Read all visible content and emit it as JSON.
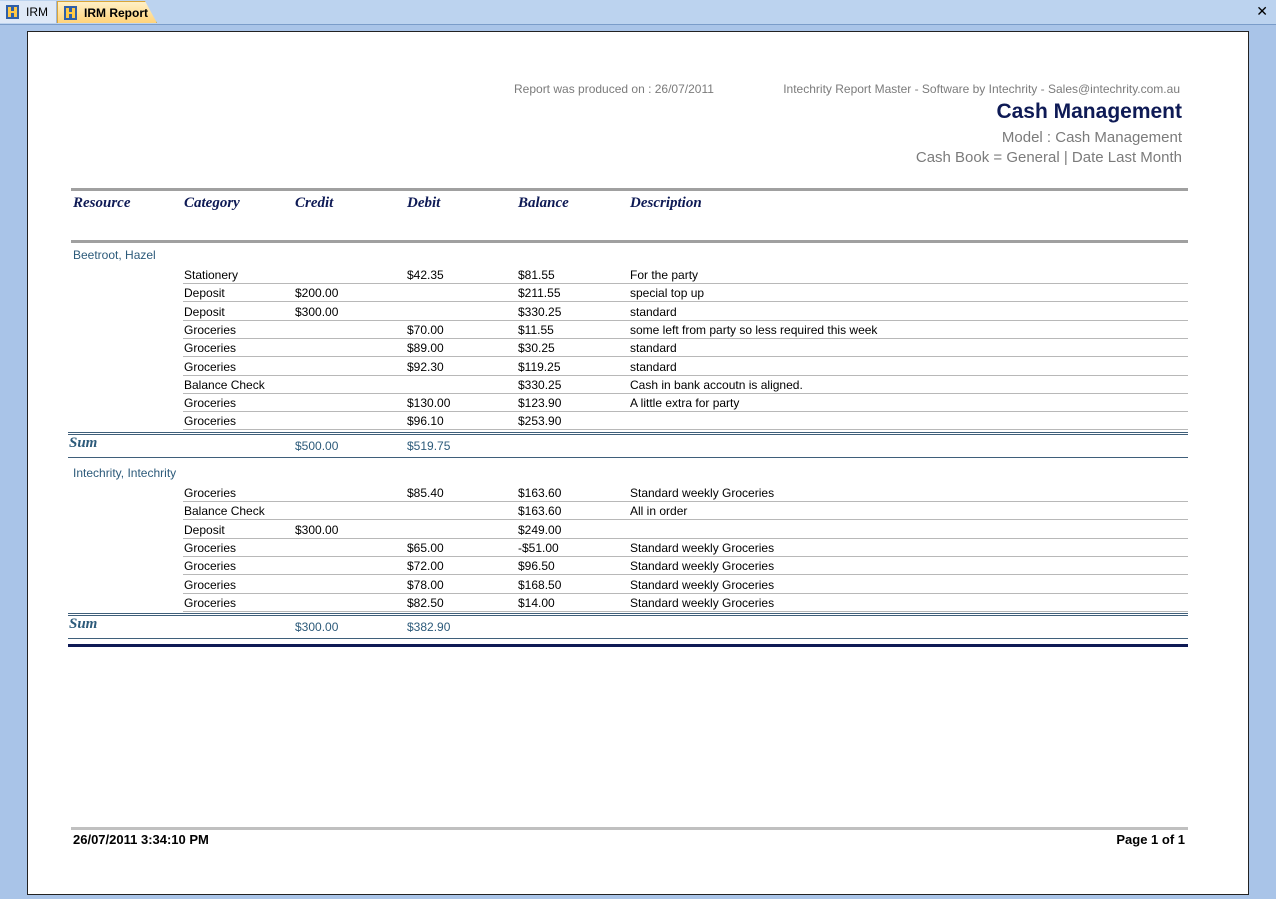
{
  "tabs": [
    {
      "label": "IRM",
      "icon": "app-logo-icon"
    },
    {
      "label": "IRM Report",
      "icon": "app-logo-icon"
    }
  ],
  "close_glyph": "✕",
  "header": {
    "produced": "Report was produced on : 26/07/2011",
    "software": "Intechrity Report Master -   Software by Intechrity  -   Sales@intechrity.com.au",
    "title": "Cash Management",
    "model": "Model : Cash Management",
    "filter": "Cash Book = General | Date Last Month"
  },
  "columns": [
    "Resource",
    "Category",
    "Credit",
    "Debit",
    "Balance",
    "Description"
  ],
  "groups": [
    {
      "name": "Beetroot, Hazel",
      "rows": [
        {
          "category": "Stationery",
          "credit": "",
          "debit": "$42.35",
          "balance": "$81.55",
          "description": "For the party"
        },
        {
          "category": "Deposit",
          "credit": "$200.00",
          "debit": "",
          "balance": "$211.55",
          "description": "special top up"
        },
        {
          "category": "Deposit",
          "credit": "$300.00",
          "debit": "",
          "balance": "$330.25",
          "description": "standard"
        },
        {
          "category": "Groceries",
          "credit": "",
          "debit": "$70.00",
          "balance": "$11.55",
          "description": "some left from party so less required this week"
        },
        {
          "category": "Groceries",
          "credit": "",
          "debit": "$89.00",
          "balance": "$30.25",
          "description": "standard"
        },
        {
          "category": "Groceries",
          "credit": "",
          "debit": "$92.30",
          "balance": "$119.25",
          "description": "standard"
        },
        {
          "category": "Balance Check",
          "credit": "",
          "debit": "",
          "balance": "$330.25",
          "description": "Cash in bank accoutn is aligned."
        },
        {
          "category": "Groceries",
          "credit": "",
          "debit": "$130.00",
          "balance": "$123.90",
          "description": "A little extra for party"
        },
        {
          "category": "Groceries",
          "credit": "",
          "debit": "$96.10",
          "balance": "$253.90",
          "description": ""
        }
      ],
      "sum": {
        "label": "Sum",
        "credit": "$500.00",
        "debit": "$519.75"
      }
    },
    {
      "name": "Intechrity, Intechrity",
      "rows": [
        {
          "category": "Groceries",
          "credit": "",
          "debit": "$85.40",
          "balance": "$163.60",
          "description": "Standard weekly Groceries"
        },
        {
          "category": "Balance Check",
          "credit": "",
          "debit": "",
          "balance": "$163.60",
          "description": "All in order"
        },
        {
          "category": "Deposit",
          "credit": "$300.00",
          "debit": "",
          "balance": "$249.00",
          "description": ""
        },
        {
          "category": "Groceries",
          "credit": "",
          "debit": "$65.00",
          "balance": "-$51.00",
          "description": "Standard weekly Groceries"
        },
        {
          "category": "Groceries",
          "credit": "",
          "debit": "$72.00",
          "balance": "$96.50",
          "description": "Standard weekly Groceries"
        },
        {
          "category": "Groceries",
          "credit": "",
          "debit": "$78.00",
          "balance": "$168.50",
          "description": "Standard weekly Groceries"
        },
        {
          "category": "Groceries",
          "credit": "",
          "debit": "$82.50",
          "balance": "$14.00",
          "description": "Standard weekly Groceries"
        }
      ],
      "sum": {
        "label": "Sum",
        "credit": "$300.00",
        "debit": "$382.90"
      }
    }
  ],
  "footer": {
    "datetime": "26/07/2011 3:34:10 PM",
    "page": "Page 1 of 1"
  }
}
